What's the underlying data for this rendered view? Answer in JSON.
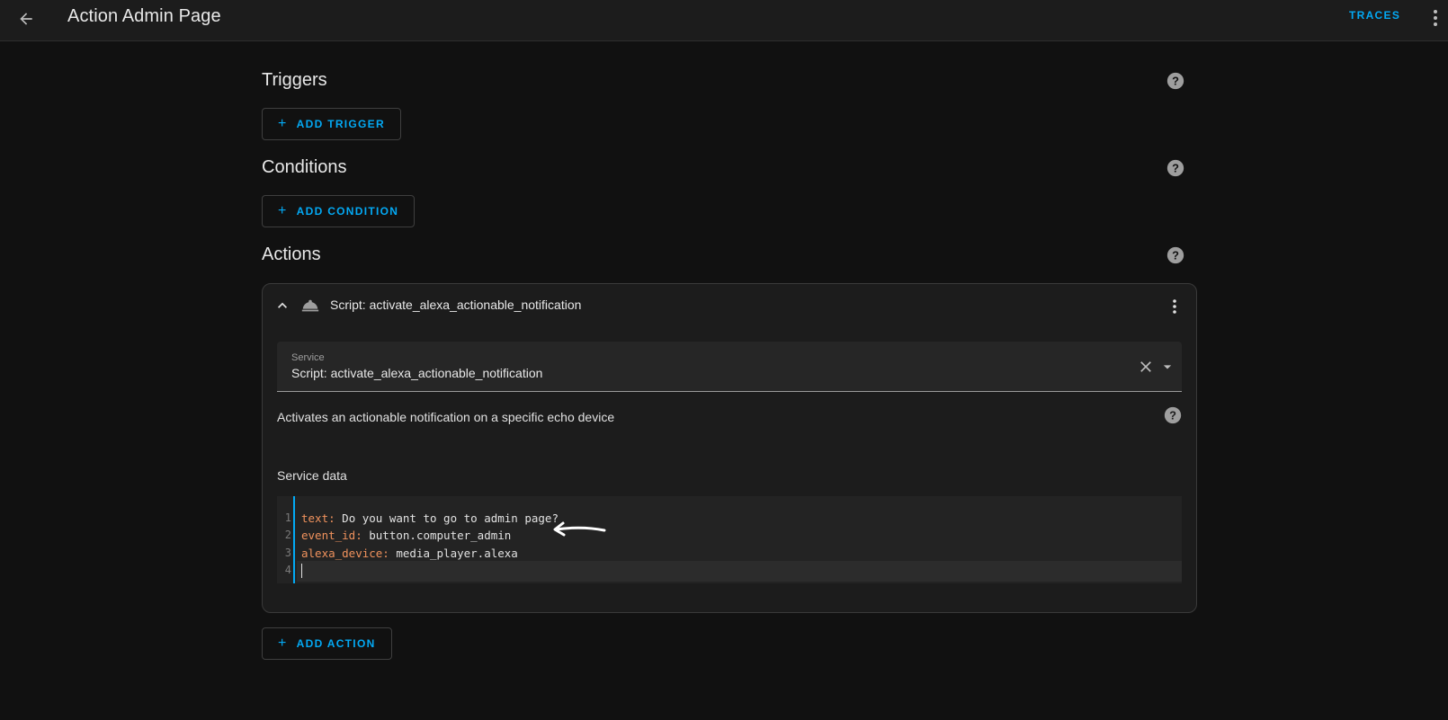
{
  "header": {
    "title": "Action Admin Page",
    "traces_label": "TRACES"
  },
  "sections": {
    "triggers": {
      "title": "Triggers",
      "add_label": "ADD TRIGGER"
    },
    "conditions": {
      "title": "Conditions",
      "add_label": "ADD CONDITION"
    },
    "actions": {
      "title": "Actions",
      "add_label": "ADD ACTION"
    }
  },
  "action_card": {
    "title": "Script: activate_alexa_actionable_notification",
    "service_field": {
      "label": "Service",
      "value": "Script: activate_alexa_actionable_notification"
    },
    "description": "Activates an actionable notification on a specific echo device",
    "service_data_label": "Service data",
    "code": {
      "line_numbers": [
        "1",
        "2",
        "3",
        "4"
      ],
      "lines": [
        {
          "key": "text:",
          "value": " Do you want to go to admin page?"
        },
        {
          "key": "event_id:",
          "value": " button.computer_admin"
        },
        {
          "key": "alexa_device:",
          "value": " media_player.alexa"
        }
      ]
    }
  },
  "icons": {
    "back": "arrow-left-icon",
    "menu": "dots-vertical-icon",
    "help": "help-circle-icon",
    "collapse": "chevron-up-icon",
    "service": "room-service-bell-icon",
    "clear": "close-icon",
    "dropdown": "menu-down-icon",
    "annotation": "hand-drawn-arrow-icon"
  },
  "colors": {
    "accent": "#03a9f4",
    "yaml_key": "#f0925d",
    "background": "#111111",
    "card": "#1c1c1c"
  }
}
